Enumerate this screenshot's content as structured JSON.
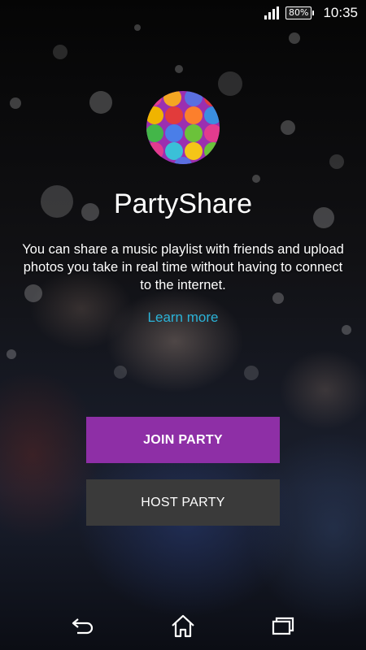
{
  "status_bar": {
    "battery": "80%",
    "time": "10:35",
    "signal_icon": "signal-icon",
    "battery_icon": "battery-icon"
  },
  "app": {
    "title": "PartyShare",
    "description": "You can share a music playlist with friends and upload photos you take in real time without having to connect to the internet.",
    "learn_more": "Learn more"
  },
  "buttons": {
    "join": "JOIN PARTY",
    "host": "HOST PARTY"
  },
  "colors": {
    "accent_purple": "#8e2fa6",
    "secondary_button": "#3a3a3a",
    "link": "#2bb3d8"
  },
  "nav_bar": {
    "back_icon": "back-icon",
    "home_icon": "home-icon",
    "recents_icon": "recents-icon"
  }
}
